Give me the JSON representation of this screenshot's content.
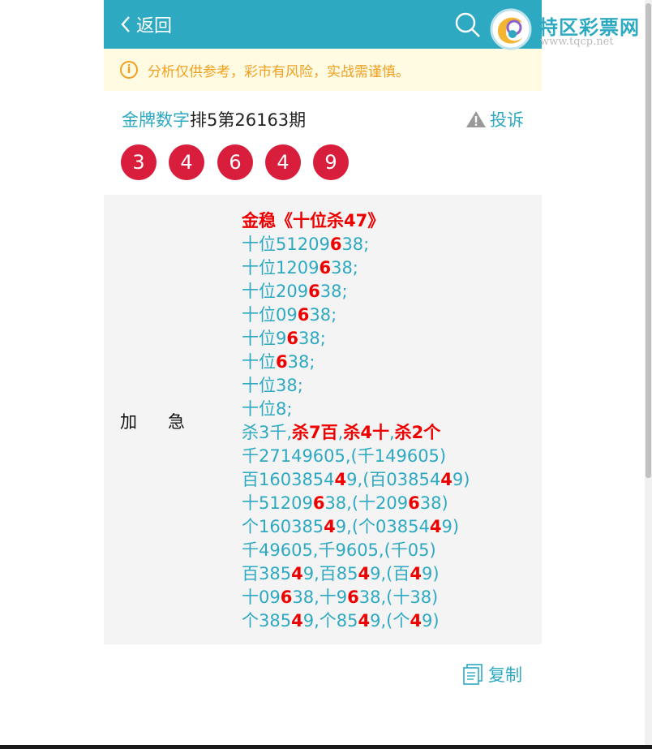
{
  "header": {
    "back_label": "返回"
  },
  "notice": {
    "text": "分析仅供参考，彩市有风险，实战需谨慎。"
  },
  "post": {
    "author": "金牌数字",
    "issue": "排5第26163期",
    "report_label": "投诉"
  },
  "balls": [
    "3",
    "4",
    "6",
    "4",
    "9"
  ],
  "tag_label": "加急",
  "content_lines": [
    [
      {
        "t": "金稳《十位杀47》",
        "r": true
      }
    ],
    [
      {
        "t": "十位51209"
      },
      {
        "t": "6",
        "r": true
      },
      {
        "t": "38;"
      }
    ],
    [
      {
        "t": "十位1209"
      },
      {
        "t": "6",
        "r": true
      },
      {
        "t": "38;"
      }
    ],
    [
      {
        "t": "十位209"
      },
      {
        "t": "6",
        "r": true
      },
      {
        "t": "38;"
      }
    ],
    [
      {
        "t": "十位09"
      },
      {
        "t": "6",
        "r": true
      },
      {
        "t": "38;"
      }
    ],
    [
      {
        "t": "十位9"
      },
      {
        "t": "6",
        "r": true
      },
      {
        "t": "38;"
      }
    ],
    [
      {
        "t": "十位"
      },
      {
        "t": "6",
        "r": true
      },
      {
        "t": "38;"
      }
    ],
    [
      {
        "t": "十位38;"
      }
    ],
    [
      {
        "t": "十位8;"
      }
    ],
    [
      {
        "t": "杀3千,"
      },
      {
        "t": "杀7百",
        "r": true
      },
      {
        "t": ","
      },
      {
        "t": "杀4十",
        "r": true
      },
      {
        "t": ","
      },
      {
        "t": "杀2个",
        "r": true
      }
    ],
    [
      {
        "t": "千27149605,(千149605)"
      }
    ],
    [
      {
        "t": "百1603854"
      },
      {
        "t": "4",
        "r": true
      },
      {
        "t": "9,(百03854"
      },
      {
        "t": "4",
        "r": true
      },
      {
        "t": "9)"
      }
    ],
    [
      {
        "t": "十51209"
      },
      {
        "t": "6",
        "r": true
      },
      {
        "t": "38,(十209"
      },
      {
        "t": "6",
        "r": true
      },
      {
        "t": "38)"
      }
    ],
    [
      {
        "t": "个160385"
      },
      {
        "t": "4",
        "r": true
      },
      {
        "t": "9,(个03854"
      },
      {
        "t": "4",
        "r": true
      },
      {
        "t": "9)"
      }
    ],
    [
      {
        "t": "千49605,千9605,(千05)"
      }
    ],
    [
      {
        "t": "百385"
      },
      {
        "t": "4",
        "r": true
      },
      {
        "t": "9,百85"
      },
      {
        "t": "4",
        "r": true
      },
      {
        "t": "9,(百"
      },
      {
        "t": "4",
        "r": true
      },
      {
        "t": "9)"
      }
    ],
    [
      {
        "t": "十09"
      },
      {
        "t": "6",
        "r": true
      },
      {
        "t": "38,十9"
      },
      {
        "t": "6",
        "r": true
      },
      {
        "t": "38,(十38)"
      }
    ],
    [
      {
        "t": "个385"
      },
      {
        "t": "4",
        "r": true
      },
      {
        "t": "9,个85"
      },
      {
        "t": "4",
        "r": true
      },
      {
        "t": "9,(个"
      },
      {
        "t": "4",
        "r": true
      },
      {
        "t": "9)"
      }
    ]
  ],
  "copy_label": "复制",
  "watermark": {
    "name": "特区彩票网",
    "url": "www.tqcp.net"
  },
  "colors": {
    "brand": "#2ea9c2",
    "ball": "#d81e3c",
    "highlight": "#e00000",
    "notice": "#f0a020"
  }
}
